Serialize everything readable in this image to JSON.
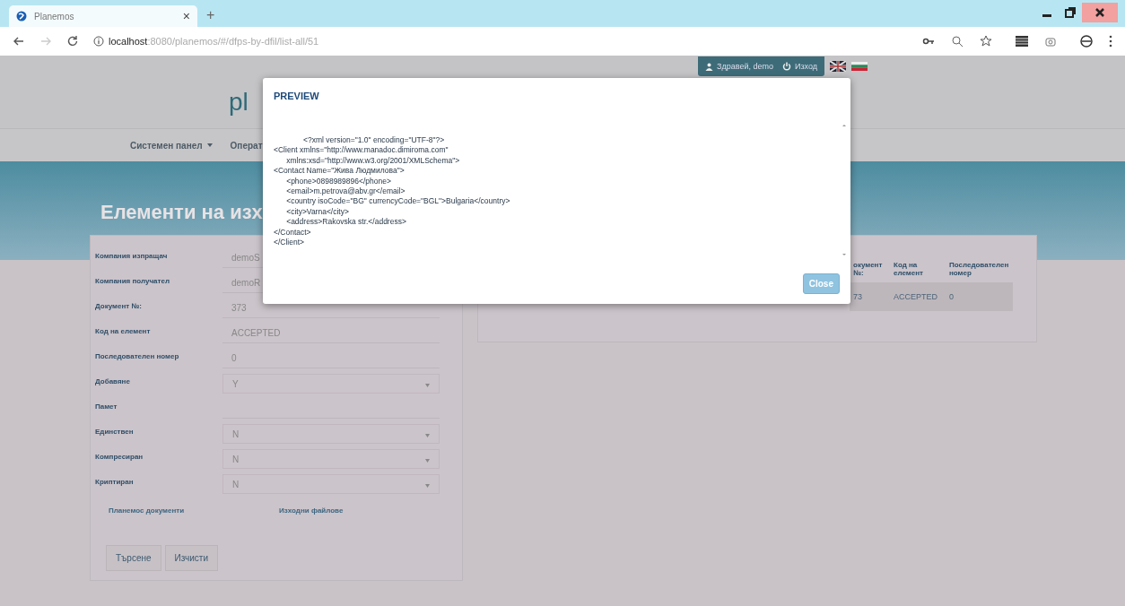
{
  "browser": {
    "tab": {
      "title": "Planemos",
      "close": "×"
    },
    "new_tab": "+",
    "address": {
      "host": "localhost",
      "path": ":8080/planemos/#/dfps-by-dfil/list-all/51"
    }
  },
  "top_bar": {
    "user": "Здравей, demo",
    "logout": "Изход"
  },
  "header": {
    "logo": "pl",
    "nav": [
      {
        "label": "Системен панел",
        "dropdown": true
      },
      {
        "label": "Операт"
      }
    ]
  },
  "page_title": "Елементи на изх",
  "form": {
    "fields": [
      {
        "label": "Компания изпращач",
        "kind": "text",
        "value": "demoS"
      },
      {
        "label": "Компания получател",
        "kind": "text",
        "value": "demoR"
      },
      {
        "label": "Документ №:",
        "kind": "text",
        "value": "373"
      },
      {
        "label": "Код на елемент",
        "kind": "text",
        "value": "ACCEPTED"
      },
      {
        "label": "Последователен номер",
        "kind": "text",
        "value": "0"
      },
      {
        "label": "Добавяне",
        "kind": "select",
        "value": "Y"
      },
      {
        "label": "Памет",
        "kind": "text"
      },
      {
        "label": "Единствен",
        "kind": "select",
        "value": "N"
      },
      {
        "label": "Компресиран",
        "kind": "select",
        "value": "N"
      },
      {
        "label": "Криптиран",
        "kind": "select",
        "value": "N"
      }
    ],
    "links": [
      "Планемос документи",
      "Изходни файлове"
    ],
    "buttons": [
      "Търсене",
      "Изчисти"
    ]
  },
  "results": {
    "columns": [
      "окумент №:",
      "Код на елемент",
      "Последователен номер"
    ],
    "rows": [
      [
        "73",
        "ACCEPTED",
        "0"
      ]
    ]
  },
  "modal": {
    "title": "PREVIEW",
    "lines": [
      "              <?xml version=\"1.0\" encoding=\"UTF-8\"?>",
      "<Client xmlns=\"http://www.manadoc.dimiroma.com\"",
      "      xmlns:xsd=\"http://www.w3.org/2001/XMLSchema\">",
      "<Contact Name=\"Жива Людмилова\">",
      "      <phone>0898989896</phone>",
      "      <email>m.petrova@abv.gr</email>",
      "      <country isoCode=\"BG\" currencyCode=\"BGL\">Bulgaria</country>",
      "      <city>Varna</city>",
      "      <address>Rakovska str.</address>",
      "</Contact>",
      "</Client>"
    ],
    "close": "Close"
  }
}
